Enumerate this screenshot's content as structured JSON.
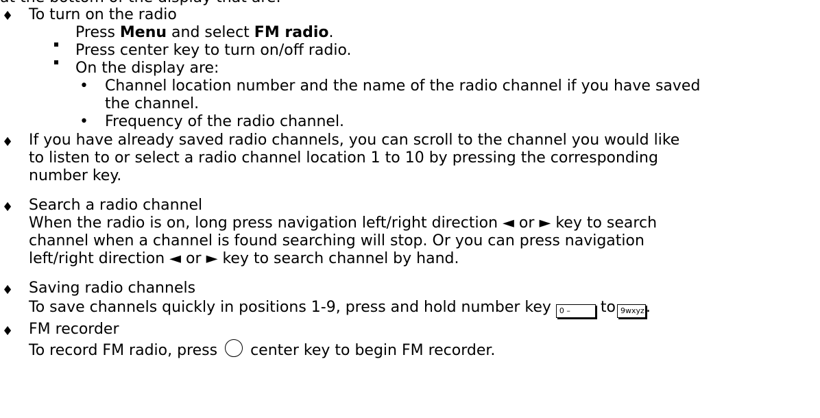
{
  "top_clip": "at the bottom of the display that are:",
  "items": {
    "turn_on": {
      "heading": "To turn on the radio",
      "step1_pre": "Press ",
      "step1_menu": "Menu",
      "step1_mid": " and select ",
      "step1_fm": "FM radio",
      "step1_post": ".",
      "step2": "Press center key to turn on/off radio.",
      "display_intro": "On the display are:",
      "display_item1_line1": "Channel location number and the name of the radio channel if you have saved",
      "display_item1_line2": "the channel.",
      "display_item2": "Frequency of the radio channel."
    },
    "saved": {
      "line1": "If you have already saved radio channels, you can scroll to the channel you would like",
      "line2": "to listen to or select a radio channel location 1 to 10 by pressing the corresponding",
      "line3": "number key."
    },
    "search": {
      "heading": "Search a radio channel",
      "line1_pre": "When the radio is on, long press navigation left/right direction ",
      "line1_mid": " or ",
      "line1_post": " key to search",
      "line2": "channel when a channel is found searching will stop. Or you can press navigation",
      "line3_pre": "left/right direction ",
      "line3_mid": " or ",
      "line3_post": " key to search channel by hand."
    },
    "saving": {
      "heading": "Saving radio channels",
      "line1_pre": "To save channels quickly in positions 1-9, press and hold number key ",
      "key_a": "0 –",
      "line1_mid": " to",
      "key_b": "9wxyz",
      "line1_post": "."
    },
    "recorder": {
      "heading": "FM recorder",
      "line1_pre": "To record FM radio, press ",
      "line1_post": " center key to begin FM recorder."
    }
  },
  "glyphs": {
    "diamond": "♦",
    "dot": "•",
    "left_arrow": "◄",
    "right_arrow": "►"
  }
}
